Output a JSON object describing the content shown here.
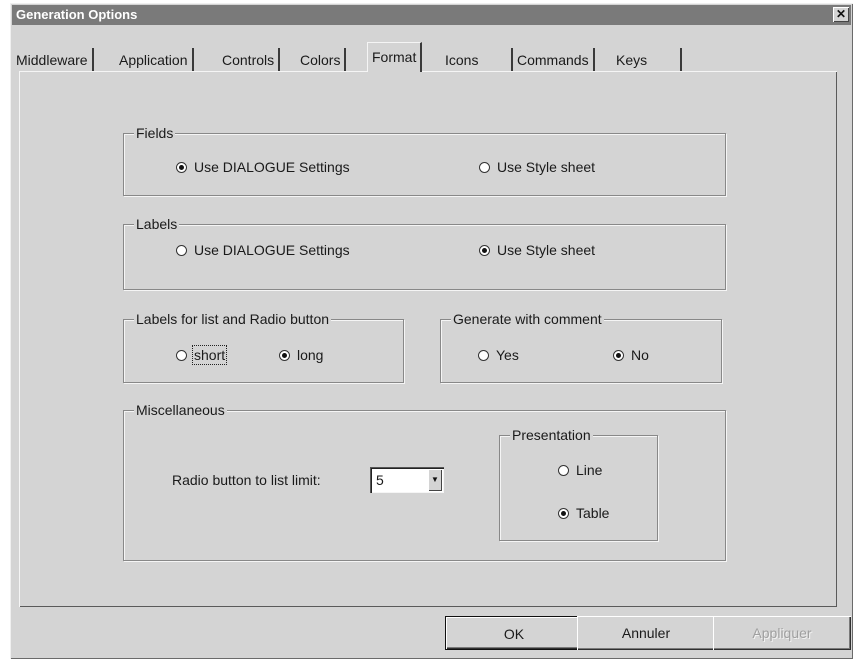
{
  "window": {
    "title": "Generation Options",
    "close_glyph": "✕"
  },
  "tabs": [
    {
      "label": "Middleware"
    },
    {
      "label": "Application"
    },
    {
      "label": "Controls"
    },
    {
      "label": "Colors"
    },
    {
      "label": "Format",
      "active": true
    },
    {
      "label": "Icons"
    },
    {
      "label": "Commands"
    },
    {
      "label": "Keys"
    }
  ],
  "fields": {
    "legend": "Fields",
    "option_dialogue": "Use DIALOGUE Settings",
    "option_style": "Use Style sheet",
    "selected": "dialogue"
  },
  "labels": {
    "legend": "Labels",
    "option_dialogue": "Use DIALOGUE Settings",
    "option_style": "Use Style sheet",
    "selected": "style"
  },
  "list_labels": {
    "legend": "Labels for list and Radio button",
    "option_short": "short",
    "option_long": "long",
    "selected": "long"
  },
  "comment": {
    "legend": "Generate with comment",
    "option_yes": "Yes",
    "option_no": "No",
    "selected": "no"
  },
  "misc": {
    "legend": "Miscellaneous",
    "limit_label": "Radio button to list limit:",
    "limit_value": "5",
    "presentation": {
      "legend": "Presentation",
      "option_line": "Line",
      "option_table": "Table",
      "selected": "table"
    }
  },
  "buttons": {
    "ok": "OK",
    "cancel": "Annuler",
    "apply": "Appliquer"
  }
}
